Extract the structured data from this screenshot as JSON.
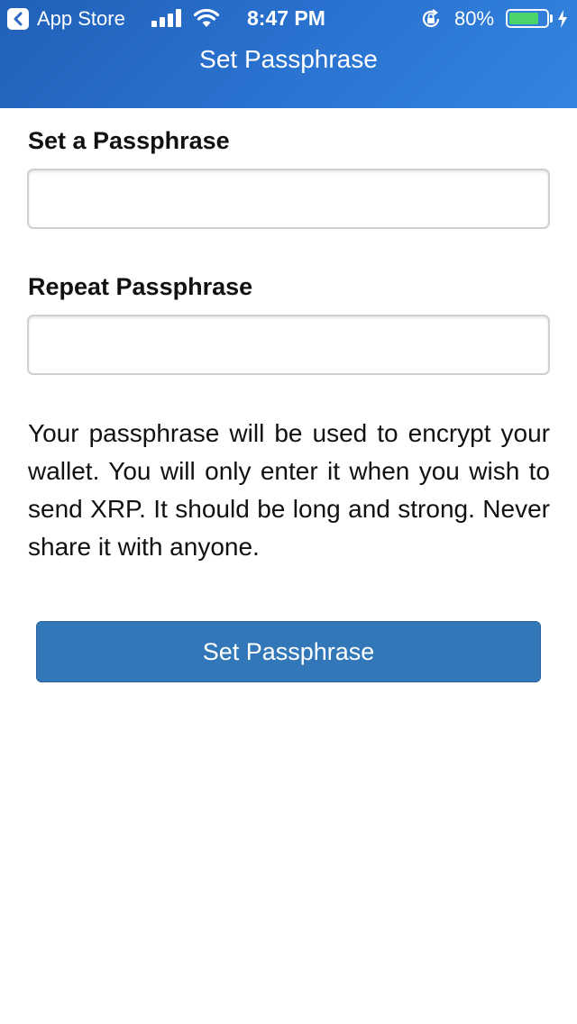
{
  "status_bar": {
    "back_app_label": "App Store",
    "time": "8:47 PM",
    "battery_percent_label": "80%",
    "battery_level": 0.8,
    "battery_color": "#4cd964"
  },
  "header": {
    "title": "Set Passphrase"
  },
  "form": {
    "passphrase_label": "Set a Passphrase",
    "passphrase_value": "",
    "repeat_label": "Repeat Passphrase",
    "repeat_value": "",
    "info_text": "Your passphrase will be used to encrypt your wallet. You will only enter it when you wish to send XRP. It should be long and strong. Never share it with anyone.",
    "submit_label": "Set Passphrase"
  },
  "colors": {
    "header_blue": "#2a72d0",
    "button_blue": "#3278b8"
  }
}
